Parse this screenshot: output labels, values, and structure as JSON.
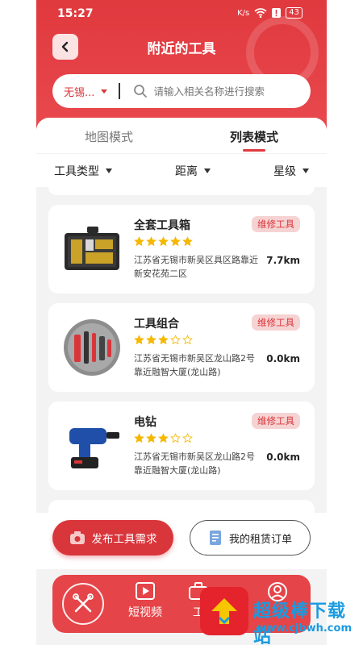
{
  "status_bar": {
    "time": "15:27",
    "net_speed": "K/s",
    "battery": "43"
  },
  "header": {
    "title": "附近的工具"
  },
  "search": {
    "city": "无锡...",
    "placeholder": "请输入相关名称进行搜索"
  },
  "view_tabs": [
    {
      "label": "地图模式",
      "active": false
    },
    {
      "label": "列表模式",
      "active": true
    }
  ],
  "filters": [
    {
      "label": "工具类型"
    },
    {
      "label": "距离"
    },
    {
      "label": "星级"
    }
  ],
  "tools": [
    {
      "name": "全套工具箱",
      "tag": "维修工具",
      "rating": 5,
      "max_rating": 5,
      "address": "江苏省无锡市新吴区具区路靠近新安花苑二区",
      "distance": "7.7km",
      "image_icon": "toolbox-icon"
    },
    {
      "name": "工具组合",
      "tag": "维修工具",
      "rating": 3,
      "max_rating": 5,
      "address": "江苏省无锡市新吴区龙山路2号靠近融智大厦(龙山路)",
      "distance": "0.0km",
      "image_icon": "tool-set-icon"
    },
    {
      "name": "电钻",
      "tag": "维修工具",
      "rating": 3,
      "max_rating": 5,
      "address": "江苏省无锡市新吴区龙山路2号靠近融智大厦(龙山路)",
      "distance": "0.0km",
      "image_icon": "drill-icon"
    }
  ],
  "actions": {
    "publish_label": "发布工具需求",
    "orders_label": "我的租赁订单"
  },
  "tabbar": {
    "video_label": "短视频",
    "tools_label": "工"
  },
  "watermark": {
    "title": "超级棒下载站",
    "url": "www.cjbwh.com"
  },
  "colors": {
    "brand_red": "#e0393e",
    "tag_bg": "#f6d3d3",
    "star": "#f5b800"
  }
}
